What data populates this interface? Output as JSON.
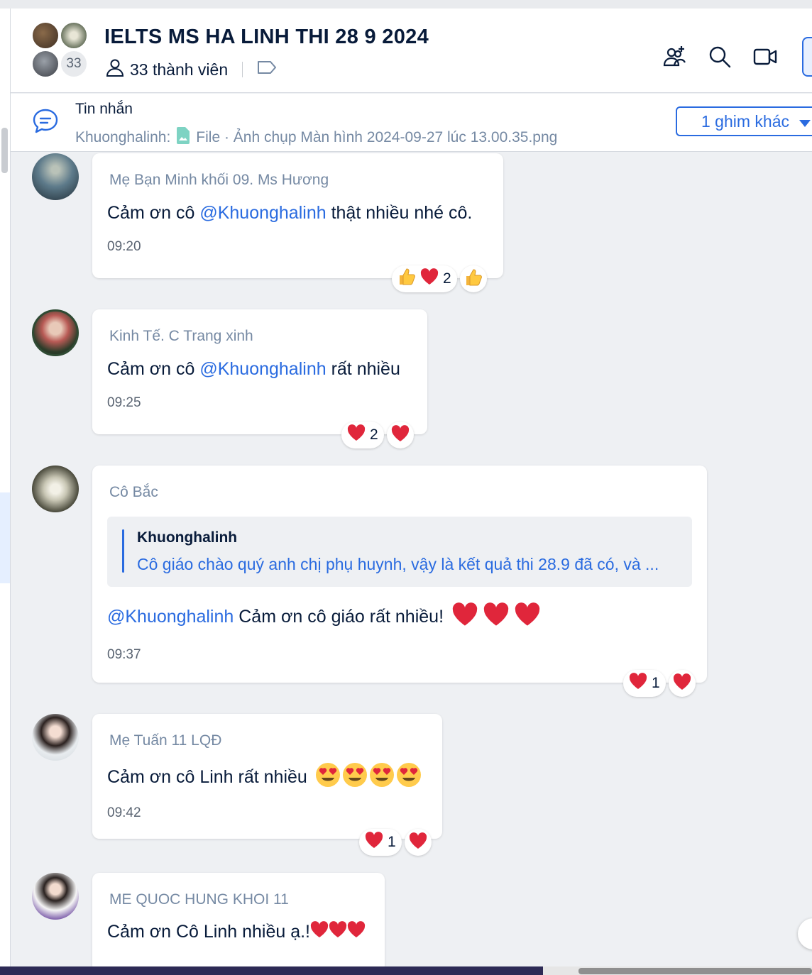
{
  "header": {
    "title": "IELTS MS HA LINH THI 28 9 2024",
    "member_count_badge": "33",
    "members_label": "33 thành viên",
    "icons": [
      "add-member-icon",
      "search-icon",
      "video-call-icon",
      "sidebar-toggle-icon"
    ]
  },
  "pinned": {
    "title": "Tin nhắn",
    "sender": "Khuonghalinh:",
    "file_text": "File · Ảnh chụp Màn hình 2024-09-27 lúc 13.00.35.png",
    "more_button": "1 ghim khác"
  },
  "messages": [
    {
      "sender": "Mẹ Bạn Minh khối 09. Ms Hương",
      "pre": "Cảm ơn cô ",
      "mention": "@Khuonghalinh",
      "post": " thật nhiều nhé cô.",
      "time": "09:20",
      "reaction_count": "2"
    },
    {
      "sender": "Kinh Tế. C Trang xinh",
      "pre": "Cảm ơn cô ",
      "mention": "@Khuonghalinh",
      "post": " rất nhiều",
      "time": "09:25",
      "reaction_count": "2"
    },
    {
      "sender": "Cô Bắc",
      "quote_name": "Khuonghalinh",
      "quote_text": "Cô giáo chào quý anh chị phụ huynh, vậy là kết quả thi 28.9 đã có, và ...",
      "mention": "@Khuonghalinh",
      "post": " Cảm ơn cô giáo rất nhiều! ",
      "time": "09:37",
      "reaction_count": "1"
    },
    {
      "sender": "Mẹ Tuấn 11 LQĐ",
      "post": "Cảm ơn cô Linh rất nhiều ",
      "time": "09:42",
      "reaction_count": "1"
    },
    {
      "sender": "ME QUOC HUNG KHOI 11",
      "post": "Cảm ơn Cô Linh nhiều ạ.!"
    }
  ],
  "colors": {
    "accent": "#2a6be0",
    "text": "#081b3a",
    "muted": "#7589a3",
    "background": "#eef0f3",
    "heart": "#e0263b"
  }
}
